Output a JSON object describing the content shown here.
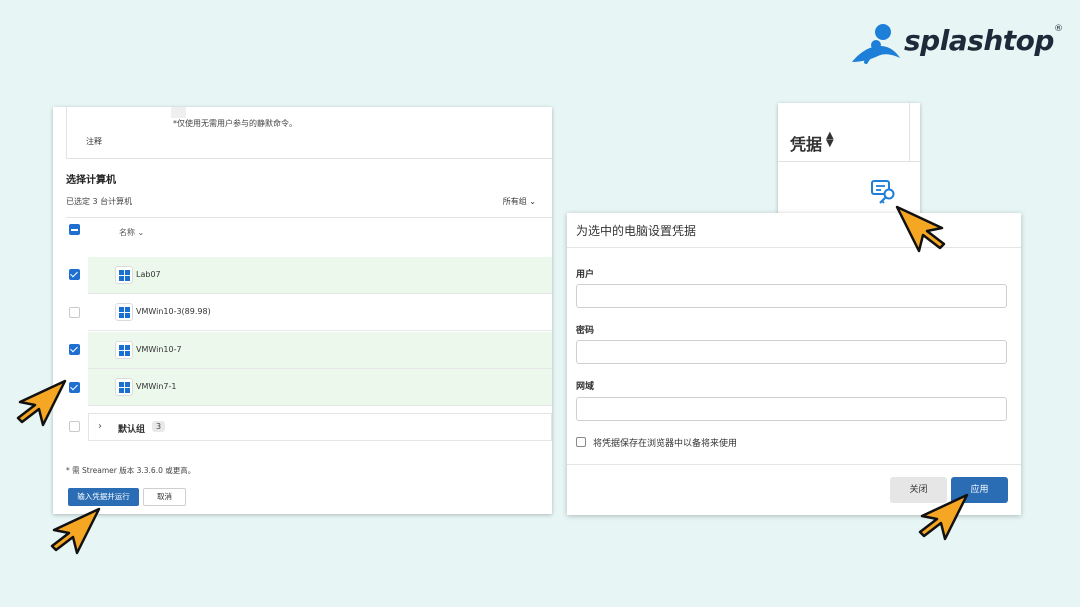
{
  "brand": {
    "name": "splashtop",
    "mark": "®",
    "logo_icon": "splashtop-logo-icon",
    "colors": {
      "logo_blue": "#1e7fd9",
      "text": "#1e2a3a",
      "background": "#e7f6f5",
      "primary": "#2a6db5",
      "selected_row": "#ecf8ec",
      "cursor_orange": "#f5a623"
    }
  },
  "left_panel": {
    "notes_hint": "*仅使用无需用户参与的静默命令。",
    "notes_label": "注释",
    "select_title": "选择计算机",
    "selected_count": "已选定 3 台计算机",
    "groups_dropdown": "所有组",
    "name_header": "名称",
    "rows": [
      {
        "label": "Lab07",
        "checked": true
      },
      {
        "label": "VMWin10-3(89.98)",
        "checked": false
      },
      {
        "label": "VMWin10-7",
        "checked": true
      },
      {
        "label": "VMWin7-1",
        "checked": true
      }
    ],
    "group": {
      "label": "默认组",
      "count": "3"
    },
    "requirement_note": "* 需 Streamer 版本 3.3.6.0 或更高。",
    "run_button": "输入凭据并运行",
    "cancel_button": "取消"
  },
  "credentials_card": {
    "column_label": "凭据",
    "sort_icon": "sort-icon",
    "action_icon": "credential-key-icon"
  },
  "dialog": {
    "title": "为选中的电脑设置凭据",
    "user_label": "用户",
    "user_value": "",
    "password_label": "密码",
    "password_value": "",
    "domain_label": "网域",
    "domain_value": "",
    "save_checkbox_label": "将凭据保存在浏览器中以备将来使用",
    "save_checked": false,
    "close_button": "关闭",
    "apply_button": "应用"
  }
}
